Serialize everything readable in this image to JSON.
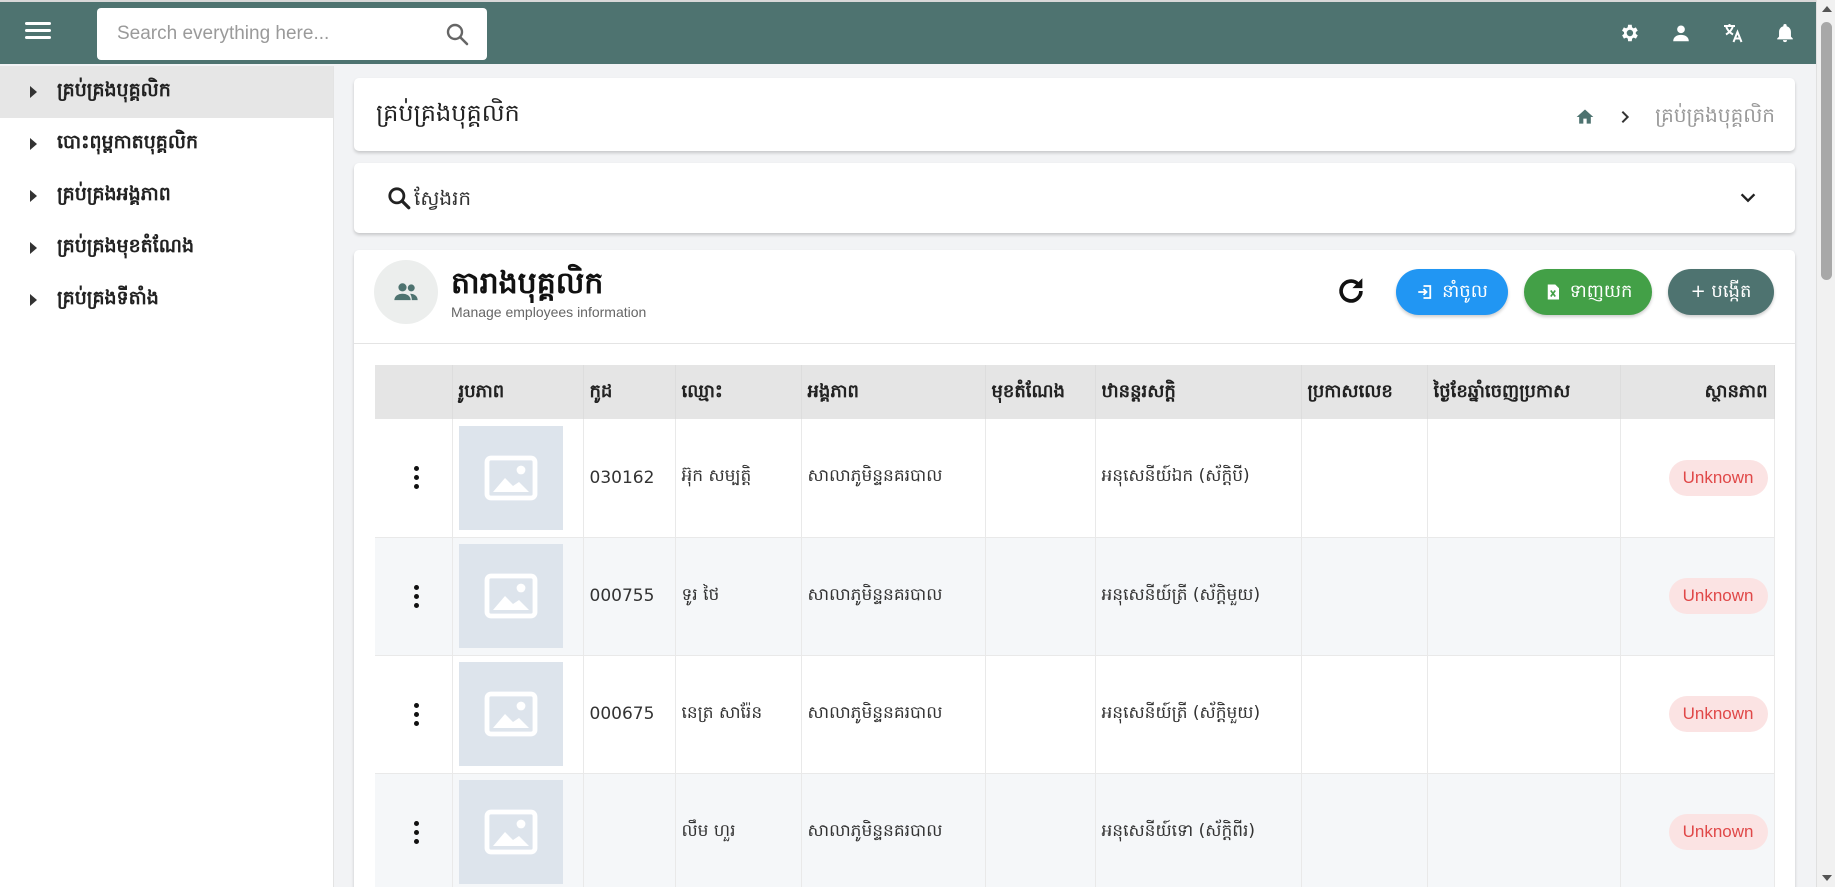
{
  "topbar": {
    "search_placeholder": "Search everything here...",
    "icons": [
      "menu-icon",
      "search-icon",
      "gear-icon",
      "user-icon",
      "translate-icon",
      "bell-icon"
    ],
    "bg_color": "#4e7370"
  },
  "sidebar": {
    "items": [
      {
        "label": "គ្រប់គ្រងបុគ្គលិក",
        "active": true
      },
      {
        "label": "បោះពុម្ពកាតបុគ្គលិក",
        "active": false
      },
      {
        "label": "គ្រប់គ្រងអង្គភាព",
        "active": false
      },
      {
        "label": "គ្រប់គ្រងមុខតំណែង",
        "active": false
      },
      {
        "label": "គ្រប់គ្រងទីតាំង",
        "active": false
      }
    ]
  },
  "header": {
    "title": "គ្រប់គ្រងបុគ្គលិក",
    "breadcrumb_current": "គ្រប់គ្រងបុគ្គលិក"
  },
  "filter": {
    "label": "ស្វែងរក"
  },
  "table_panel": {
    "title": "តារាងបុគ្គលិក",
    "subtitle": "Manage employees information",
    "import_label": "នាំចូល",
    "export_label": "ទាញយក",
    "create_label": "+ បង្កើត",
    "colors": {
      "import": "#2196f3",
      "export": "#43a047",
      "create": "#4e7370"
    }
  },
  "table": {
    "columns": [
      "",
      "រូបភាព",
      "កូដ",
      "ឈ្មោះ",
      "អង្គភាព",
      "មុខតំណែង",
      "ឋានន្តរសក្តិ",
      "ប្រកាសលេខ",
      "ថ្ងៃខែឆ្នាំចេញប្រកាស",
      "ស្ថានភាព"
    ],
    "rows": [
      {
        "code": "030162",
        "name": "អ៊ុក សម្បត្តិ",
        "unit": "សាលាភូមិន្ទនគរបាល",
        "position": "",
        "rank": "អនុសេនីយ៍ឯក (ស័ក្តិបី)",
        "decree_no": "",
        "decree_date": "",
        "status": "Unknown"
      },
      {
        "code": "000755",
        "name": "ទូរ ថៃ",
        "unit": "សាលាភូមិន្ទនគរបាល",
        "position": "",
        "rank": "អនុសេនីយ៍ត្រី (ស័ក្តិមួយ)",
        "decree_no": "",
        "decree_date": "",
        "status": "Unknown"
      },
      {
        "code": "000675",
        "name": "នេត្រ សារ៉ែន",
        "unit": "សាលាភូមិន្ទនគរបាល",
        "position": "",
        "rank": "អនុសេនីយ៍ត្រី (ស័ក្តិមួយ)",
        "decree_no": "",
        "decree_date": "",
        "status": "Unknown"
      },
      {
        "code": "",
        "name": "លឹម ហួរ",
        "unit": "សាលាភូមិន្ទនគរបាល",
        "position": "",
        "rank": "អនុសេនីយ៍ទោ (ស័ក្តិពីរ)",
        "decree_no": "",
        "decree_date": "",
        "status": "Unknown"
      }
    ]
  }
}
